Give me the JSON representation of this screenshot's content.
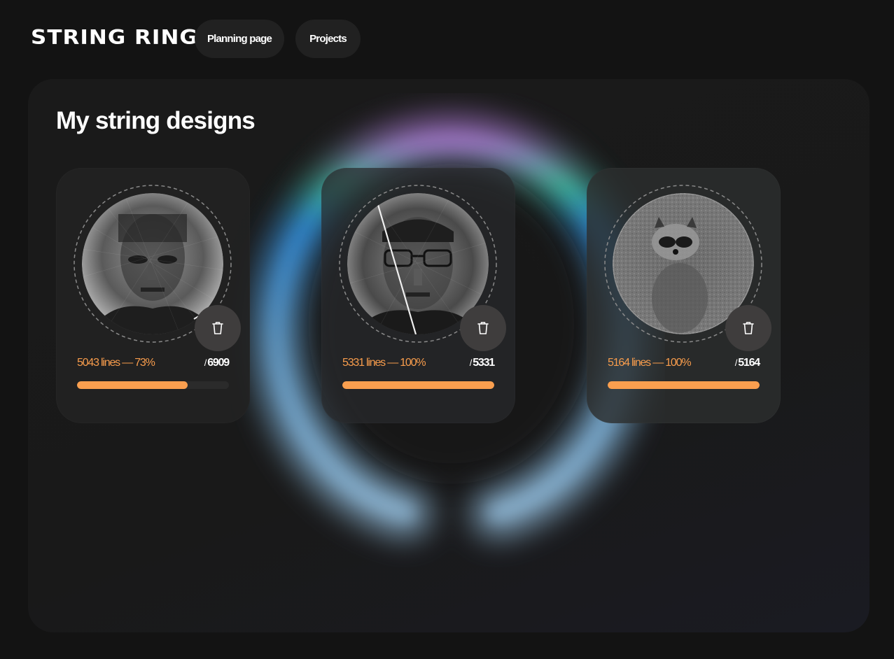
{
  "app": {
    "logo_text": "STRING RING"
  },
  "nav": {
    "planning_label": "Planning page",
    "projects_label": "Projects"
  },
  "main": {
    "title": "My string designs",
    "designs": [
      {
        "stat_text": "5043 lines — 73%",
        "total_lines": "6909",
        "progress_fraction": 0.73,
        "subject": "portrait of a man",
        "delete_icon": "trash-icon"
      },
      {
        "stat_text": "5331 lines — 100%",
        "total_lines": "5331",
        "progress_fraction": 1.0,
        "subject": "portrait of a man with glasses",
        "delete_icon": "trash-icon"
      },
      {
        "stat_text": "5164 lines — 100%",
        "total_lines": "5164",
        "progress_fraction": 1.0,
        "subject": "raccoon",
        "delete_icon": "trash-icon"
      }
    ]
  },
  "colors": {
    "accent": "#fa9f4f",
    "background": "#131313",
    "panel": "#1a1a1a",
    "card": "#262626"
  },
  "total_prefix": "/"
}
